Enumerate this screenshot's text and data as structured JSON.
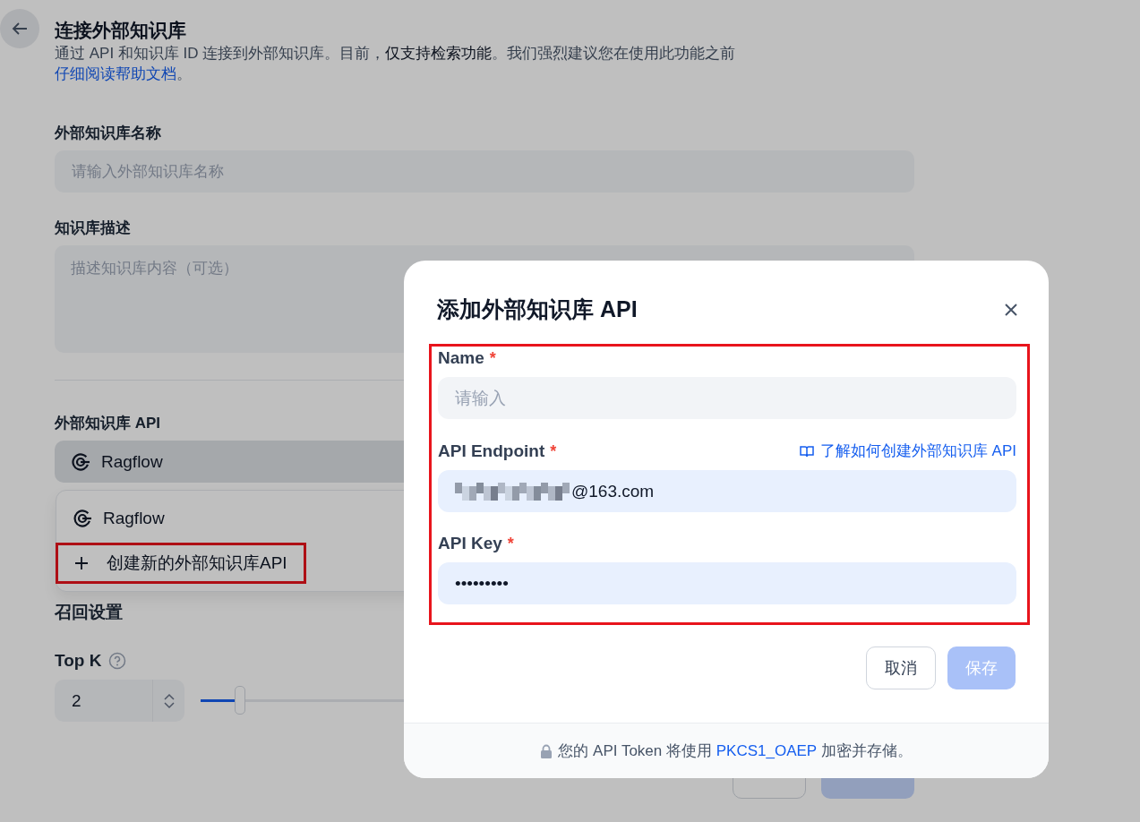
{
  "page": {
    "title": "连接外部知识库",
    "description": "通过 API 和知识库 ID 连接到外部知识库。目前，**仅支持检索功能**。我们强烈建议您在使用此功能之前",
    "description_link": "仔细阅读帮助文档",
    "description_end": "。"
  },
  "name_field": {
    "label": "外部知识库名称",
    "placeholder": "请输入外部知识库名称"
  },
  "description_field": {
    "label": "知识库描述",
    "placeholder": "描述知识库内容（可选）"
  },
  "api_select": {
    "label": "外部知识库 API",
    "value": "Ragflow",
    "expanded": true,
    "options": [
      {
        "kind": "provider",
        "label": "Ragflow"
      },
      {
        "kind": "create",
        "label": "创建新的外部知识库API"
      }
    ]
  },
  "retrieval": {
    "title": "召回设置",
    "top_k": {
      "label": "Top K",
      "value": "2",
      "level": 0.05
    }
  },
  "dialog": {
    "title": "添加外部知识库 API",
    "fields": [
      {
        "kind": "text",
        "label": "Name",
        "required_mark": "*",
        "placeholder": "请输入"
      },
      {
        "kind": "redacted",
        "label": "API Endpoint",
        "required_mark": "*",
        "value": "@163.com",
        "help_link": "了解如何创建外部知识库 API"
      },
      {
        "kind": "text",
        "label": "API Key",
        "required_mark": "*",
        "value": "•••••••••"
      }
    ],
    "buttons": [
      {
        "kind": "secondary",
        "label": "取消",
        "disabled": false
      },
      {
        "kind": "primary",
        "label": "保存",
        "disabled": true
      }
    ],
    "notice": {
      "prefix": "您的 API Token 将使用 ",
      "link": "PKCS1_OAEP",
      "suffix": " 加密并存储。"
    }
  }
}
